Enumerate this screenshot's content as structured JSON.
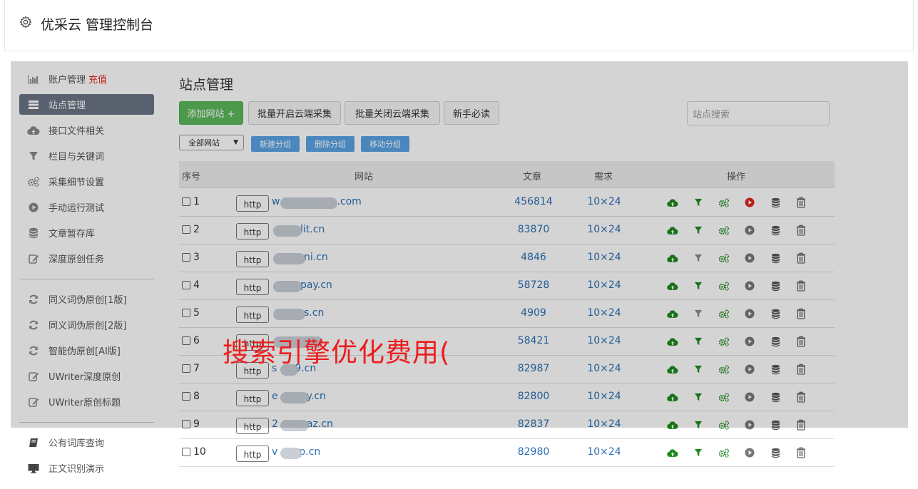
{
  "header": {
    "title": "优采云 管理控制台"
  },
  "sidebar": {
    "items": [
      {
        "label": "账户管理",
        "extra": "充值",
        "icon": "bar-chart-icon"
      },
      {
        "label": "站点管理",
        "icon": "server-icon"
      },
      {
        "label": "接口文件相关",
        "icon": "cloud-upload-icon"
      },
      {
        "label": "栏目与关键词",
        "icon": "filter-icon"
      },
      {
        "label": "采集细节设置",
        "icon": "gears-icon"
      },
      {
        "label": "手动运行测试",
        "icon": "play-circle-icon"
      },
      {
        "label": "文章暂存库",
        "icon": "database-icon"
      },
      {
        "label": "深度原创任务",
        "icon": "edit-icon"
      },
      {
        "label": "同义词伪原创[1版]",
        "icon": "refresh-icon"
      },
      {
        "label": "同义词伪原创[2版]",
        "icon": "refresh-icon"
      },
      {
        "label": "智能伪原创[AI版]",
        "icon": "refresh-icon"
      },
      {
        "label": "UWriter深度原创",
        "icon": "edit-icon"
      },
      {
        "label": "UWriter原创标题",
        "icon": "edit-icon"
      },
      {
        "label": "公有词库查询",
        "icon": "book-icon"
      },
      {
        "label": "正文识别演示",
        "icon": "monitor-icon"
      }
    ]
  },
  "main": {
    "title": "站点管理",
    "buttons": {
      "add_site": "添加网站 +",
      "batch_open": "批量开启云端采集",
      "batch_close": "批量关闭云端采集",
      "beginner": "新手必读"
    },
    "search_placeholder": "站点搜索",
    "group_select": "全部网站",
    "group_buttons": {
      "new": "新建分组",
      "delete": "删除分组",
      "move": "移动分组"
    },
    "table": {
      "headers": {
        "index": "序号",
        "site": "网站",
        "articles": "文章",
        "demand": "需求",
        "ops": "操作"
      },
      "rows": [
        {
          "num": "1",
          "scheme": "http",
          "site_prefix": "w",
          "site_suffix": ".com",
          "articles": "456814",
          "demand": "10×24",
          "running": true
        },
        {
          "num": "2",
          "scheme": "http",
          "site_prefix": "",
          "site_suffix": "lit.cn",
          "articles": "83870",
          "demand": "10×24",
          "running": false
        },
        {
          "num": "3",
          "scheme": "http",
          "site_prefix": "",
          "site_suffix": "ni.cn",
          "articles": "4846",
          "demand": "10×24",
          "running": false
        },
        {
          "num": "4",
          "scheme": "http",
          "site_prefix": "",
          "site_suffix": "pay.cn",
          "articles": "58728",
          "demand": "10×24",
          "running": false
        },
        {
          "num": "5",
          "scheme": "http",
          "site_prefix": "",
          "site_suffix": "s.cn",
          "articles": "4909",
          "demand": "10×24",
          "running": false
        },
        {
          "num": "6",
          "scheme": "http",
          "site_prefix": "",
          "site_suffix": "",
          "articles": "58421",
          "demand": "10×24",
          "running": false
        },
        {
          "num": "7",
          "scheme": "http",
          "site_prefix": "s",
          "site_suffix": "9.cn",
          "articles": "82987",
          "demand": "10×24",
          "running": false
        },
        {
          "num": "8",
          "scheme": "http",
          "site_prefix": "e",
          "site_suffix": "y.cn",
          "articles": "82800",
          "demand": "10×24",
          "running": false
        },
        {
          "num": "9",
          "scheme": "http",
          "site_prefix": "2",
          "site_suffix": "az.cn",
          "articles": "82837",
          "demand": "10×24",
          "running": false
        },
        {
          "num": "10",
          "scheme": "http",
          "site_prefix": "v",
          "site_suffix": "p.cn",
          "articles": "82980",
          "demand": "10×24",
          "running": false
        }
      ]
    }
  },
  "watermark": "搜索引擎优化费用(",
  "colors": {
    "green": "#5cb85c",
    "blue": "#5aa3e6",
    "link": "#2a6fb3",
    "red": "#e1251b",
    "active_nav": "#6b7485"
  }
}
